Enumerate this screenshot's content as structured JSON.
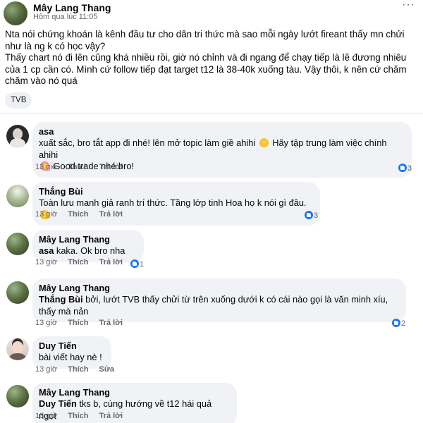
{
  "post": {
    "author": "Mây Lang Thang",
    "time": "Hôm qua lúc 11:05",
    "paragraph1": "Nta nói chứng khoán là kênh đầu tư cho dân tri thức mà sao mỗi ngày lướt fireant thấy mn chửi như là ng k có học vậy?",
    "paragraph2": "Thấy chart nó đi lên cũng khá nhiều rồi, giờ nó chỉnh và đi ngang để chạy tiếp là lẽ đương nhiêu của 1 cp cần có. Mình cứ follow tiếp đạt target t12 là 38-40k xuống tàu. Vậy thôi, k nên cứ chăm chăm vào nó quá",
    "tag": "TVB"
  },
  "actions": {
    "like": "Thích",
    "reply": "Trả lời",
    "edit": "Sửa"
  },
  "comments": [
    {
      "author": "asa",
      "text1": "xuất sắc, bro tắt app đi nhé! lên mở topic làm giề ahihi",
      "text2": "Hãy tập trung làm việc chính ahihi",
      "text3": "Good trade nhé bro!",
      "time": "13 giờ",
      "likes": "3"
    },
    {
      "author": "Thắng Bùi",
      "text": "Toàn lưu manh giả ranh trí thức. Tầng lớp tinh Hoa họ k nói gì đâu.",
      "time": "13 giờ",
      "likes": "3"
    },
    {
      "author": "Mây Lang Thang",
      "mention": "asa",
      "text": "kaka. Ok bro nha",
      "time": "13 giờ",
      "likes": "1"
    },
    {
      "author": "Mây Lang Thang",
      "mention": "Thắng Bùi",
      "text": "bởi, lướt TVB thấy chửi từ trên xuống dưới k có cái nào gọi là văn minh xíu, thấy mà nản",
      "time": "13 giờ",
      "likes": "2"
    },
    {
      "author": "Duy Tiến",
      "text": "bài viết hay nè !",
      "time": "13 giờ"
    },
    {
      "author": "Mây Lang Thang",
      "mention": "Duy Tiến",
      "text": "tks b, cùng hướng về t12 hái quả ngọt",
      "time": "13 giờ"
    }
  ],
  "icons": {
    "more": "more-horizontal-icon",
    "like": "thumbs-up-icon",
    "colors": {
      "like": "#1877f2",
      "bubble": "#f0f2f5",
      "meta": "#65676b"
    }
  }
}
